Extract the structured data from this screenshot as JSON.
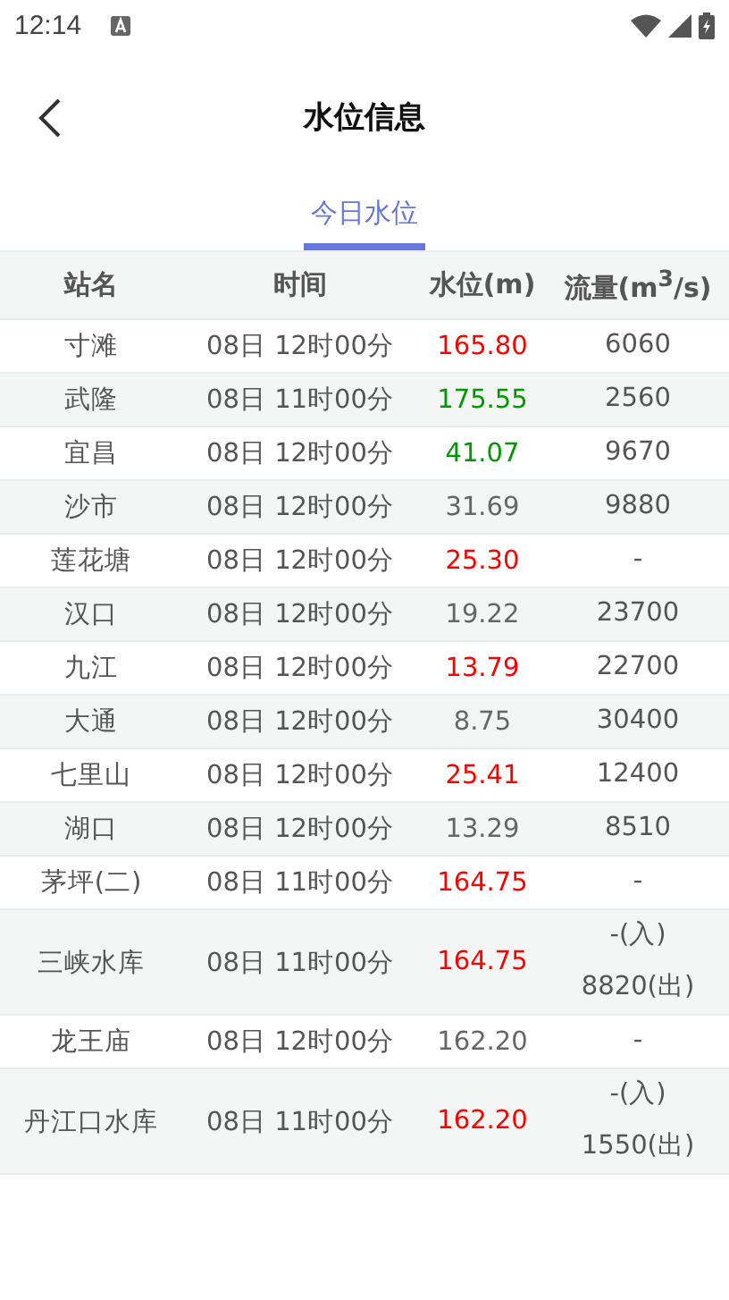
{
  "status_bar": {
    "time": "12:14"
  },
  "header": {
    "title": "水位信息"
  },
  "tabs": [
    {
      "label": "今日水位",
      "selected": true
    }
  ],
  "table": {
    "columns": [
      "站名",
      "时间",
      "水位(m)",
      "流量(m$^{3}$/s)"
    ],
    "rows": [
      {
        "name": "寸滩",
        "time": "08日 12时00分",
        "level": "165.80",
        "color": "#ff0000",
        "flow": [
          "6060"
        ]
      },
      {
        "name": "武隆",
        "time": "08日 11时00分",
        "level": "175.55",
        "color": "#009900",
        "flow": [
          "2560"
        ]
      },
      {
        "name": "宜昌",
        "time": "08日 12时00分",
        "level": "41.07",
        "color": "#009900",
        "flow": [
          "9670"
        ]
      },
      {
        "name": "沙市",
        "time": "08日 12时00分",
        "level": "31.69",
        "color": "#666666",
        "flow": [
          "9880"
        ]
      },
      {
        "name": "莲花塘",
        "time": "08日 12时00分",
        "level": "25.30",
        "color": "#ff0000",
        "flow": [
          "-"
        ]
      },
      {
        "name": "汉口",
        "time": "08日 12时00分",
        "level": "19.22",
        "color": "#666666",
        "flow": [
          "23700"
        ]
      },
      {
        "name": "九江",
        "time": "08日 12时00分",
        "level": "13.79",
        "color": "#ff0000",
        "flow": [
          "22700"
        ]
      },
      {
        "name": "大通",
        "time": "08日 12时00分",
        "level": "8.75",
        "color": "#666666",
        "flow": [
          "30400"
        ]
      },
      {
        "name": "七里山",
        "time": "08日 12时00分",
        "level": "25.41",
        "color": "#ff0000",
        "flow": [
          "12400"
        ]
      },
      {
        "name": "湖口",
        "time": "08日 12时00分",
        "level": "13.29",
        "color": "#666666",
        "flow": [
          "8510"
        ]
      },
      {
        "name": "茅坪(二)",
        "time": "08日 11时00分",
        "level": "164.75",
        "color": "#ff0000",
        "flow": [
          "-"
        ]
      },
      {
        "name": "三峡水库",
        "time": "08日 11时00分",
        "level": "164.75",
        "color": "#ff0000",
        "flow": [
          "-(入)",
          "8820(出)"
        ]
      },
      {
        "name": "龙王庙",
        "time": "08日 12时00分",
        "level": "162.20",
        "color": "#666666",
        "flow": [
          "-"
        ]
      },
      {
        "name": "丹江口水库",
        "time": "08日 11时00分",
        "level": "162.20",
        "color": "#ff0000",
        "flow": [
          "-(入)",
          "1550(出)"
        ]
      }
    ]
  }
}
